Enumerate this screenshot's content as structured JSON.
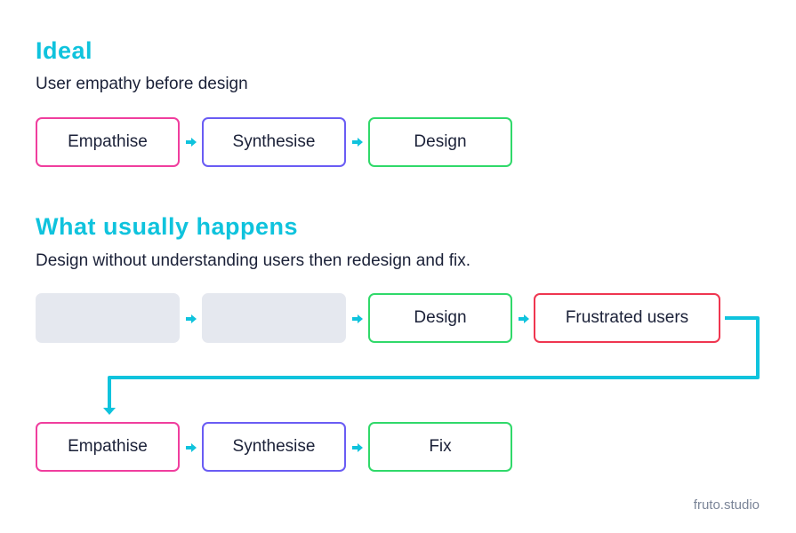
{
  "sections": {
    "ideal": {
      "heading": "Ideal",
      "subtitle": "User empathy before design",
      "steps": [
        "Empathise",
        "Synthesise",
        "Design"
      ]
    },
    "usual": {
      "heading": "What usually happens",
      "subtitle": "Design without understanding users then redesign and fix.",
      "row1": [
        "",
        "",
        "Design",
        "Frustrated users"
      ],
      "row2": [
        "Empathise",
        "Synthesise",
        "Fix"
      ]
    }
  },
  "colors": {
    "accent": "#0fc3dd",
    "empathise": "#f03e9e",
    "synthesise": "#6a5cf4",
    "design": "#30d96a",
    "frustrated": "#ef3650",
    "placeholder": "#e5e8ef"
  },
  "footer": "fruto.studio"
}
